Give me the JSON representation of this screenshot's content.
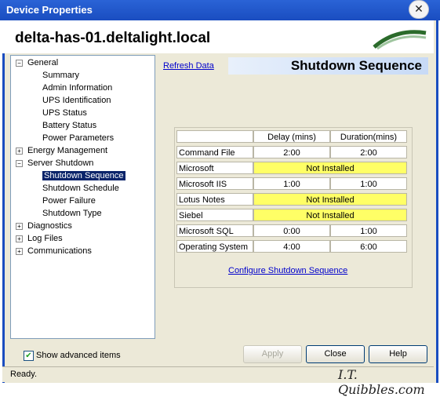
{
  "window": {
    "title": "Device Properties",
    "close_glyph": "✕"
  },
  "header": {
    "hostname": "delta-has-01.deltalight.local"
  },
  "tree": {
    "items": [
      {
        "label": "General",
        "level": 0,
        "expander": "−"
      },
      {
        "label": "Summary",
        "level": 1
      },
      {
        "label": "Admin Information",
        "level": 1
      },
      {
        "label": "UPS Identification",
        "level": 1
      },
      {
        "label": "UPS Status",
        "level": 1
      },
      {
        "label": "Battery Status",
        "level": 1
      },
      {
        "label": "Power Parameters",
        "level": 1
      },
      {
        "label": "Energy Management",
        "level": 0,
        "expander": "+"
      },
      {
        "label": "Server Shutdown",
        "level": 0,
        "expander": "−"
      },
      {
        "label": "Shutdown Sequence",
        "level": 1,
        "selected": true
      },
      {
        "label": "Shutdown Schedule",
        "level": 1
      },
      {
        "label": "Power Failure",
        "level": 1
      },
      {
        "label": "Shutdown Type",
        "level": 1
      },
      {
        "label": "Diagnostics",
        "level": 0,
        "expander": "+"
      },
      {
        "label": "Log Files",
        "level": 0,
        "expander": "+"
      },
      {
        "label": "Communications",
        "level": 0,
        "expander": "+"
      }
    ]
  },
  "main": {
    "refresh_label": "Refresh Data",
    "section_title": "Shutdown Sequence",
    "table": {
      "headers": [
        "",
        "Delay (mins)",
        "Duration(mins)"
      ],
      "rows": [
        {
          "name": "Command File",
          "delay": "2:00",
          "duration": "2:00"
        },
        {
          "name": "Microsoft Exchange",
          "not_installed": "Not Installed"
        },
        {
          "name": "Microsoft IIS",
          "delay": "1:00",
          "duration": "1:00"
        },
        {
          "name": "Lotus Notes",
          "not_installed": "Not Installed"
        },
        {
          "name": "Siebel",
          "not_installed": "Not Installed"
        },
        {
          "name": "Microsoft SQL",
          "delay": "0:00",
          "duration": "1:00"
        },
        {
          "name": "Operating System",
          "delay": "4:00",
          "duration": "6:00"
        }
      ]
    },
    "configure_label": "Configure Shutdown Sequence"
  },
  "footer": {
    "show_advanced_label": "Show advanced items",
    "show_advanced_checked": true,
    "apply_label": "Apply",
    "close_label": "Close",
    "help_label": "Help",
    "status": "Ready.",
    "watermark": "I.T. Quibbles.com"
  },
  "colors": {
    "titlebar": "#1a4dc0",
    "selection": "#0a246a",
    "not_installed": "#ffff66",
    "link": "#0000cc"
  }
}
